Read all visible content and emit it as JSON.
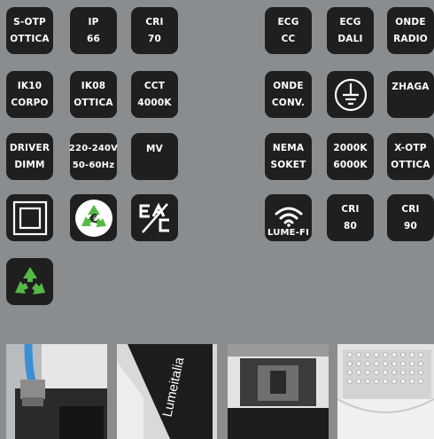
{
  "tiles": [
    {
      "id": "s-otp",
      "l1": "S-OTP",
      "l2": "OTTICA"
    },
    {
      "id": "ip66",
      "l1": "IP",
      "l2": "66"
    },
    {
      "id": "cri70",
      "l1": "CRI",
      "l2": "70"
    },
    {
      "id": "ecg-cc",
      "l1": "ECG",
      "l2": "CC"
    },
    {
      "id": "ecg-dali",
      "l1": "ECG",
      "l2": "DALI"
    },
    {
      "id": "onde-radio",
      "l1": "ONDE",
      "l2": "RADIO"
    },
    {
      "id": "ik10",
      "l1": "IK10",
      "l2": "CORPO"
    },
    {
      "id": "ik08",
      "l1": "IK08",
      "l2": "OTTICA"
    },
    {
      "id": "cct",
      "l1": "CCT",
      "l2": "4000K"
    },
    {
      "id": "onde-conv",
      "l1": "ONDE",
      "l2": "CONV."
    },
    {
      "id": "zhaga",
      "l1": "ZHAGA"
    },
    {
      "id": "driver",
      "l1": "DRIVER",
      "l2": "DIMM"
    },
    {
      "id": "voltage",
      "l1": "220-240V",
      "l2": "50-60Hz"
    },
    {
      "id": "mv",
      "l1": "MV"
    },
    {
      "id": "nema",
      "l1": "NEMA",
      "l2": "SOKET"
    },
    {
      "id": "cct-range",
      "l1": "2000K",
      "l2": "6000K"
    },
    {
      "id": "x-otp",
      "l1": "X-OTP",
      "l2": "OTTICA"
    },
    {
      "id": "lume-fi",
      "l1": "LUME-FI"
    },
    {
      "id": "cri80",
      "l1": "CRI",
      "l2": "80"
    },
    {
      "id": "cri90",
      "l1": "CRI",
      "l2": "90"
    }
  ],
  "icons": {
    "class2": "double-insulation-icon",
    "ground": "earth-ground-icon",
    "raee": "recycling-euro-icon",
    "eac": "eac-mark-icon",
    "wifi": "wifi-icon",
    "recycle": "recycle-icon",
    "recycle_color": "#55b947",
    "euro_symbol": "€"
  },
  "photos": {
    "brand": "Lumeitalia"
  }
}
